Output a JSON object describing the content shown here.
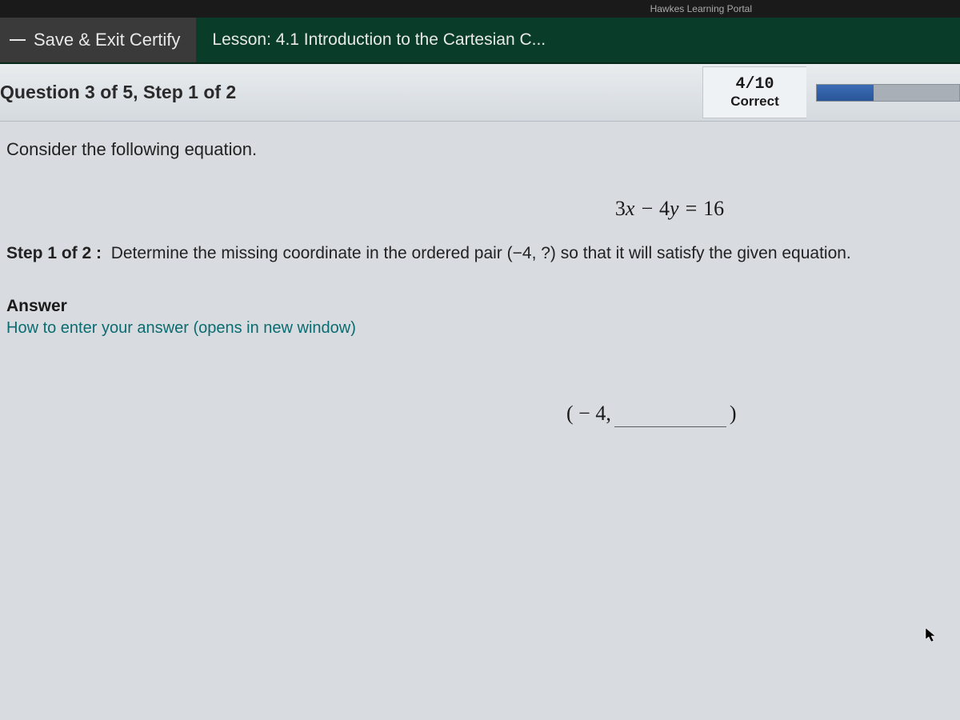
{
  "browser": {
    "tab_hint": "Hawkes Learning Portal"
  },
  "topbar": {
    "save_exit_label": "Save & Exit Certify",
    "lesson_title": "Lesson: 4.1 Introduction to the Cartesian C..."
  },
  "header": {
    "question_label": "Question 3 of 5, Step 1 of 2",
    "score_value": "4/10",
    "score_label": "Correct",
    "progress_percent": 40
  },
  "body": {
    "prompt": "Consider the following equation.",
    "equation_text": "3x − 4y = 16",
    "step_label": "Step 1 of 2 :",
    "step_text": "Determine the missing coordinate in the ordered pair (−4,  ?) so that it will satisfy the given equation.",
    "answer_heading": "Answer",
    "help_link": "How to enter your answer (opens in new window)",
    "pair_prefix": "( − 4,",
    "pair_suffix": ")",
    "answer_value": ""
  }
}
